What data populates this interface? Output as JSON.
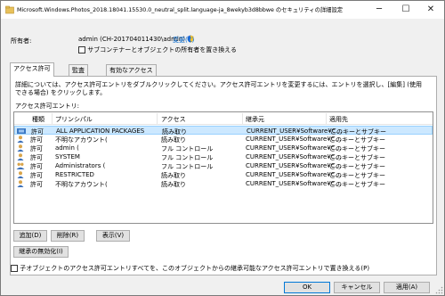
{
  "window": {
    "title": "Microsoft.Windows.Photos_2018.18041.15530.0_neutral_split.language-ja_8wekyb3d8bbwe のセキュリティの詳細設定",
    "minimize": "─",
    "maximize": "☐",
    "close": "✕"
  },
  "owner": {
    "label": "所有者:",
    "value": "admin (CH-201704011430\\admin)",
    "change_link": "変更(C)",
    "replace_label": "サブコンテナーとオブジェクトの所有者を置き換える"
  },
  "tabs": [
    "アクセス許可",
    "監査",
    "有効なアクセス"
  ],
  "description": "詳細については、アクセス許可エントリをダブルクリックしてください。アクセス許可エントリを変更するには、エントリを選択し、[編集] (使用できる場合) をクリックします。",
  "list_caption": "アクセス許可エントリ:",
  "columns": [
    "種類",
    "プリンシパル",
    "アクセス",
    "継承元",
    "適用先"
  ],
  "entries": [
    {
      "icon": "group-icon",
      "type": "許可",
      "principal": "ALL APPLICATION PACKAGES",
      "access": "読み取り",
      "inherited": "CURRENT_USER¥Software¥C...",
      "applies": "このキーとサブキー",
      "selected": true
    },
    {
      "icon": "user-icon",
      "type": "許可",
      "principal": "不明なアカウント(",
      "access": "読み取り",
      "inherited": "CURRENT_USER¥Software¥C...",
      "applies": "このキーとサブキー",
      "selected": false
    },
    {
      "icon": "user-icon",
      "type": "許可",
      "principal": "admin (",
      "access": "フル コントロール",
      "inherited": "CURRENT_USER¥Software¥C...",
      "applies": "このキーとサブキー",
      "selected": false
    },
    {
      "icon": "user-icon",
      "type": "許可",
      "principal": "SYSTEM",
      "access": "フル コントロール",
      "inherited": "CURRENT_USER¥Software¥C...",
      "applies": "このキーとサブキー",
      "selected": false
    },
    {
      "icon": "group-icon",
      "type": "許可",
      "principal": "Administrators (",
      "access": "フル コントロール",
      "inherited": "CURRENT_USER¥Software¥C...",
      "applies": "このキーとサブキー",
      "selected": false
    },
    {
      "icon": "user-icon",
      "type": "許可",
      "principal": "RESTRICTED",
      "access": "読み取り",
      "inherited": "CURRENT_USER¥Software¥C...",
      "applies": "このキーとサブキー",
      "selected": false
    },
    {
      "icon": "user-icon",
      "type": "許可",
      "principal": "不明なアカウント(",
      "access": "読み取り",
      "inherited": "CURRENT_USER¥Software¥C...",
      "applies": "このキーとサブキー",
      "selected": false
    }
  ],
  "buttons": {
    "add": "追加(D)",
    "remove": "削除(R)",
    "view": "表示(V)",
    "disable_inheritance": "継承の無効化(I)",
    "ok": "OK",
    "cancel": "キャンセル",
    "apply": "適用(A)"
  },
  "inherit_replace_label": "子オブジェクトのアクセス許可エントリすべてを、このオブジェクトからの継承可能なアクセス許可エントリで置き換える(P)",
  "colors": {
    "selection": "#cce8ff",
    "link": "#0066cc",
    "accent": "#0078d7"
  }
}
